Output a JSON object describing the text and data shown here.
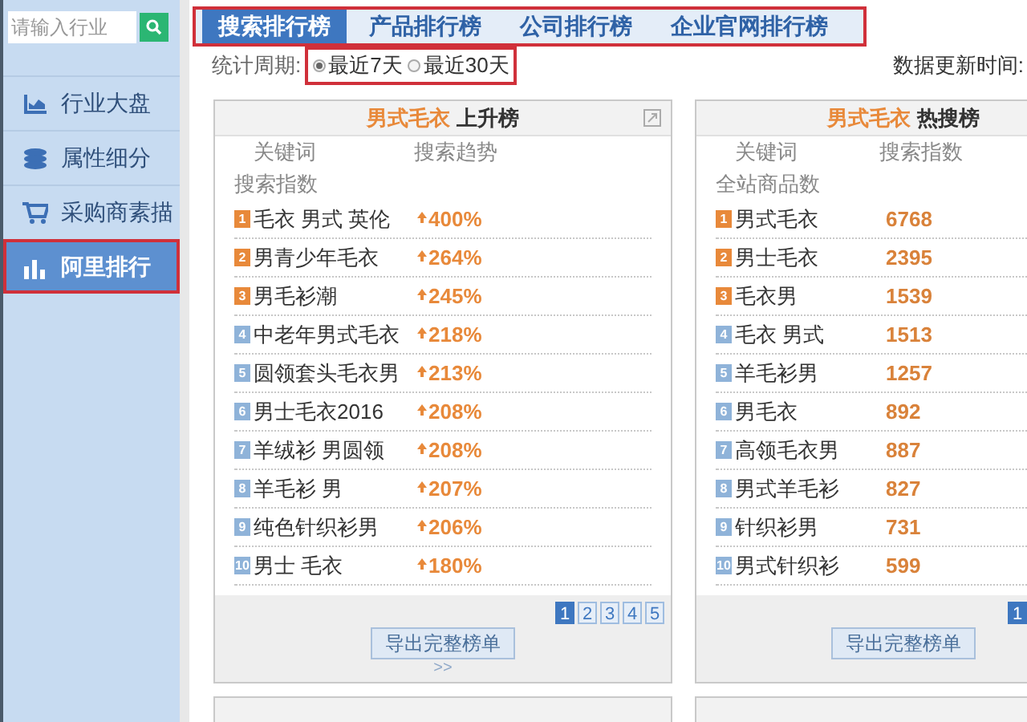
{
  "search": {
    "placeholder": "请输入行业"
  },
  "sidebar": {
    "items": [
      {
        "label": "行业大盘",
        "kind": "area",
        "selected": false,
        "annotated": false
      },
      {
        "label": "属性细分",
        "kind": "layers",
        "selected": false,
        "annotated": false
      },
      {
        "label": "采购商素描",
        "kind": "cart",
        "selected": false,
        "annotated": false
      },
      {
        "label": "阿里排行",
        "kind": "bars",
        "selected": true,
        "annotated": true
      }
    ]
  },
  "tabs": [
    {
      "label": "搜索排行榜",
      "selected": true
    },
    {
      "label": "产品排行榜",
      "selected": false
    },
    {
      "label": "公司排行榜",
      "selected": false
    },
    {
      "label": "企业官网排行榜",
      "selected": false
    }
  ],
  "period": {
    "label": "统计周期:",
    "options": [
      {
        "label": "最近7天",
        "selected": true
      },
      {
        "label": "最近30天",
        "selected": false
      }
    ]
  },
  "update_label": "数据更新时间:",
  "panels": [
    {
      "keyword": "男式毛衣",
      "title": "上升榜",
      "kind": "trend",
      "popout": true,
      "columns": [
        "关键词",
        "搜索趋势"
      ],
      "sub_label": "搜索指数",
      "rows": [
        {
          "rank": "1",
          "keyword": "毛衣 男式 英伦",
          "value": "400%"
        },
        {
          "rank": "2",
          "keyword": "男青少年毛衣",
          "value": "264%"
        },
        {
          "rank": "3",
          "keyword": "男毛衫潮",
          "value": "245%"
        },
        {
          "rank": "4",
          "keyword": "中老年男式毛衣",
          "value": "218%"
        },
        {
          "rank": "5",
          "keyword": "圆领套头毛衣男",
          "value": "213%"
        },
        {
          "rank": "6",
          "keyword": "男士毛衣2016",
          "value": "208%"
        },
        {
          "rank": "7",
          "keyword": "羊绒衫 男圆领",
          "value": "208%"
        },
        {
          "rank": "8",
          "keyword": "羊毛衫 男",
          "value": "207%"
        },
        {
          "rank": "9",
          "keyword": "纯色针织衫男",
          "value": "206%"
        },
        {
          "rank": "10",
          "keyword": "男士 毛衣",
          "value": "180%"
        }
      ],
      "pages": [
        {
          "label": "1",
          "selected": true
        },
        {
          "label": "2",
          "selected": false
        },
        {
          "label": "3",
          "selected": false
        },
        {
          "label": "4",
          "selected": false
        },
        {
          "label": "5",
          "selected": false
        }
      ],
      "export": "导出完整榜单",
      "more": ">>"
    },
    {
      "keyword": "男式毛衣",
      "title": "热搜榜",
      "kind": "count",
      "popout": false,
      "columns": [
        "关键词",
        "搜索指数"
      ],
      "sub_label": "全站商品数",
      "rows": [
        {
          "rank": "1",
          "keyword": "男式毛衣",
          "value": "6768"
        },
        {
          "rank": "2",
          "keyword": "男士毛衣",
          "value": "2395"
        },
        {
          "rank": "3",
          "keyword": "毛衣男",
          "value": "1539"
        },
        {
          "rank": "4",
          "keyword": "毛衣 男式",
          "value": "1513"
        },
        {
          "rank": "5",
          "keyword": "羊毛衫男",
          "value": "1257"
        },
        {
          "rank": "6",
          "keyword": "男毛衣",
          "value": "892"
        },
        {
          "rank": "7",
          "keyword": "高领毛衣男",
          "value": "887"
        },
        {
          "rank": "8",
          "keyword": "男式羊毛衫",
          "value": "827"
        },
        {
          "rank": "9",
          "keyword": "针织衫男",
          "value": "731"
        },
        {
          "rank": "10",
          "keyword": "男式针织衫",
          "value": "599"
        }
      ],
      "pages": [
        {
          "label": "1",
          "selected": true
        }
      ],
      "export": "导出完整榜单"
    }
  ]
}
